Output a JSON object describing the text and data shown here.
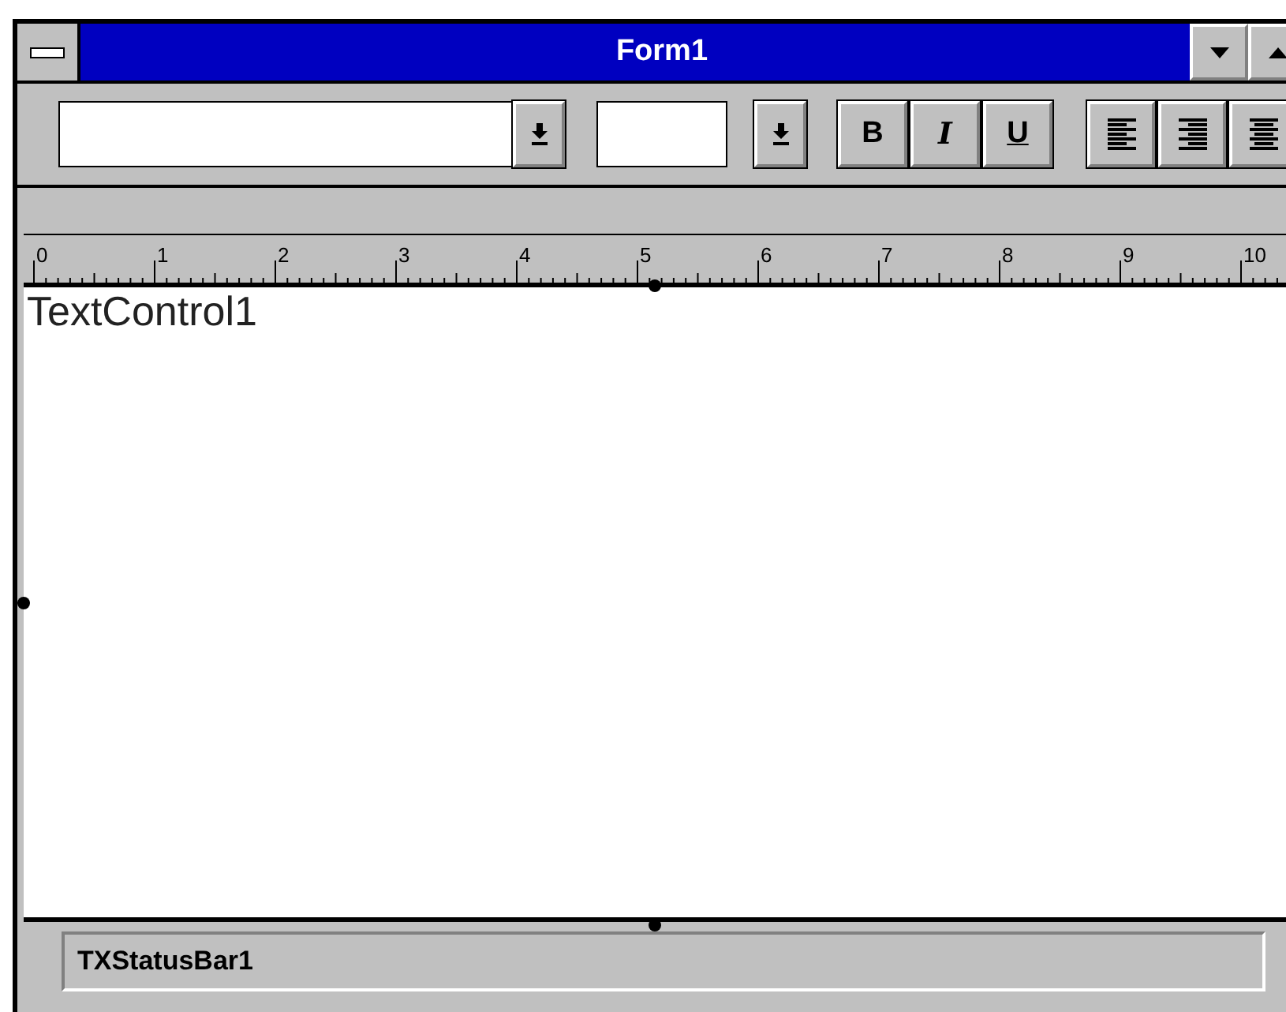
{
  "window": {
    "title": "Form1"
  },
  "toolbar": {
    "style_buttons": [
      {
        "label": "B",
        "kind": "bold"
      },
      {
        "label": "I",
        "kind": "italic"
      },
      {
        "label": "U",
        "kind": "underline"
      }
    ],
    "align_buttons": [
      {
        "kind": "left"
      },
      {
        "kind": "right"
      },
      {
        "kind": "center"
      }
    ]
  },
  "ruler": {
    "labels": [
      "0",
      "1",
      "2",
      "3",
      "4",
      "5",
      "6",
      "7",
      "8",
      "9",
      "10"
    ]
  },
  "editor": {
    "text": "TextControl1"
  },
  "status_bar": {
    "text": "TXStatusBar1"
  }
}
